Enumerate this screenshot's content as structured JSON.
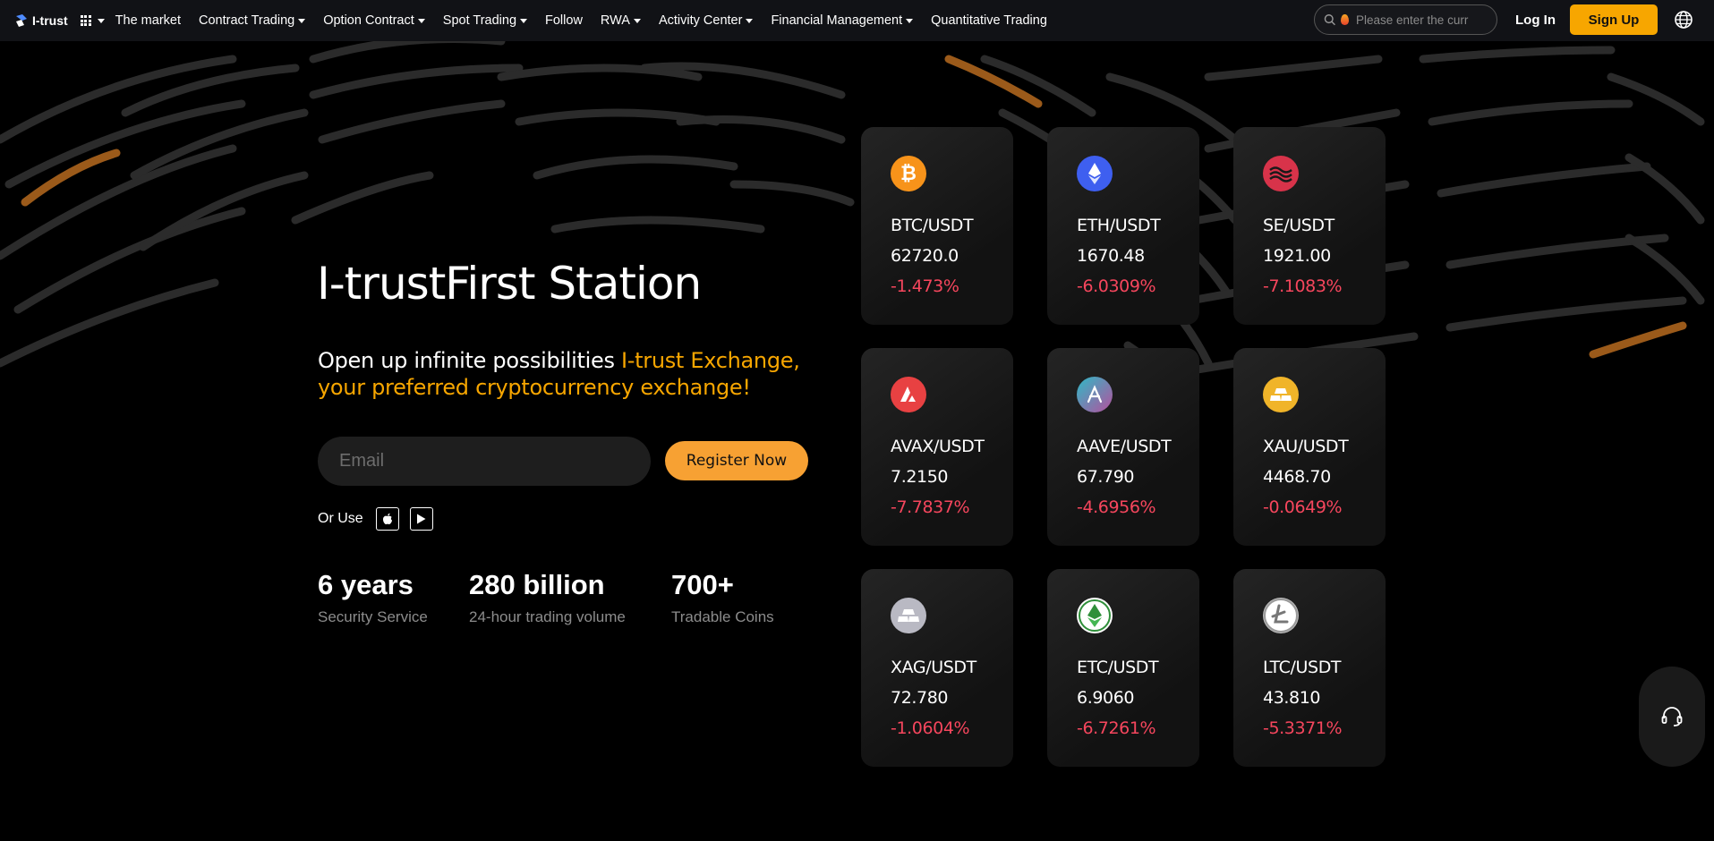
{
  "header": {
    "logo_text": "I-trust",
    "nav": [
      {
        "label": "The market",
        "dropdown": false
      },
      {
        "label": "Contract Trading",
        "dropdown": true
      },
      {
        "label": "Option Contract",
        "dropdown": true
      },
      {
        "label": "Spot Trading",
        "dropdown": true
      },
      {
        "label": "Follow",
        "dropdown": false
      },
      {
        "label": "RWA",
        "dropdown": true
      },
      {
        "label": "Activity Center",
        "dropdown": true
      },
      {
        "label": "Financial Management",
        "dropdown": true
      },
      {
        "label": "Quantitative Trading",
        "dropdown": false
      }
    ],
    "search_placeholder": "Please enter the curr",
    "login_label": "Log In",
    "signup_label": "Sign Up"
  },
  "hero": {
    "title": "I-trustFirst Station",
    "subtitle_plain": "Open up infinite possibilities ",
    "subtitle_accent": "I-trust Exchange, your preferred cryptocurrency exchange!",
    "email_placeholder": "Email",
    "register_label": "Register Now",
    "or_use_label": "Or Use"
  },
  "stats": [
    {
      "value": "6 years",
      "label": "Security Service"
    },
    {
      "value": "280 billion",
      "label": "24-hour trading volume"
    },
    {
      "value": "700+",
      "label": "Tradable Coins"
    }
  ],
  "markets": [
    {
      "pair": "BTC/USDT",
      "price": "62720.0",
      "change": "-1.473%",
      "icon": "btc-icon",
      "color": "#f7931a"
    },
    {
      "pair": "ETH/USDT",
      "price": "1670.48",
      "change": "-6.0309%",
      "icon": "eth-icon",
      "color": "#3e5ff0"
    },
    {
      "pair": "SE/USDT",
      "price": "1921.00",
      "change": "-7.1083%",
      "icon": "se-icon",
      "color": "#d8334a"
    },
    {
      "pair": "AVAX/USDT",
      "price": "7.2150",
      "change": "-7.7837%",
      "icon": "avax-icon",
      "color": "#e84142"
    },
    {
      "pair": "AAVE/USDT",
      "price": "67.790",
      "change": "-4.6956%",
      "icon": "aave-icon",
      "color": "#7a5fbf"
    },
    {
      "pair": "XAU/USDT",
      "price": "4468.70",
      "change": "-0.0649%",
      "icon": "xau-icon",
      "color": "#f0b429"
    },
    {
      "pair": "XAG/USDT",
      "price": "72.780",
      "change": "-1.0604%",
      "icon": "xag-icon",
      "color": "#b9b9c3"
    },
    {
      "pair": "ETC/USDT",
      "price": "6.9060",
      "change": "-6.7261%",
      "icon": "etc-icon",
      "color": "#2f8f3a"
    },
    {
      "pair": "LTC/USDT",
      "price": "43.810",
      "change": "-5.3371%",
      "icon": "ltc-icon",
      "color": "#bdbdbd"
    }
  ],
  "colors": {
    "accent": "#f7a600",
    "negative": "#f6465d",
    "card_bg": "#1a1a1a"
  }
}
